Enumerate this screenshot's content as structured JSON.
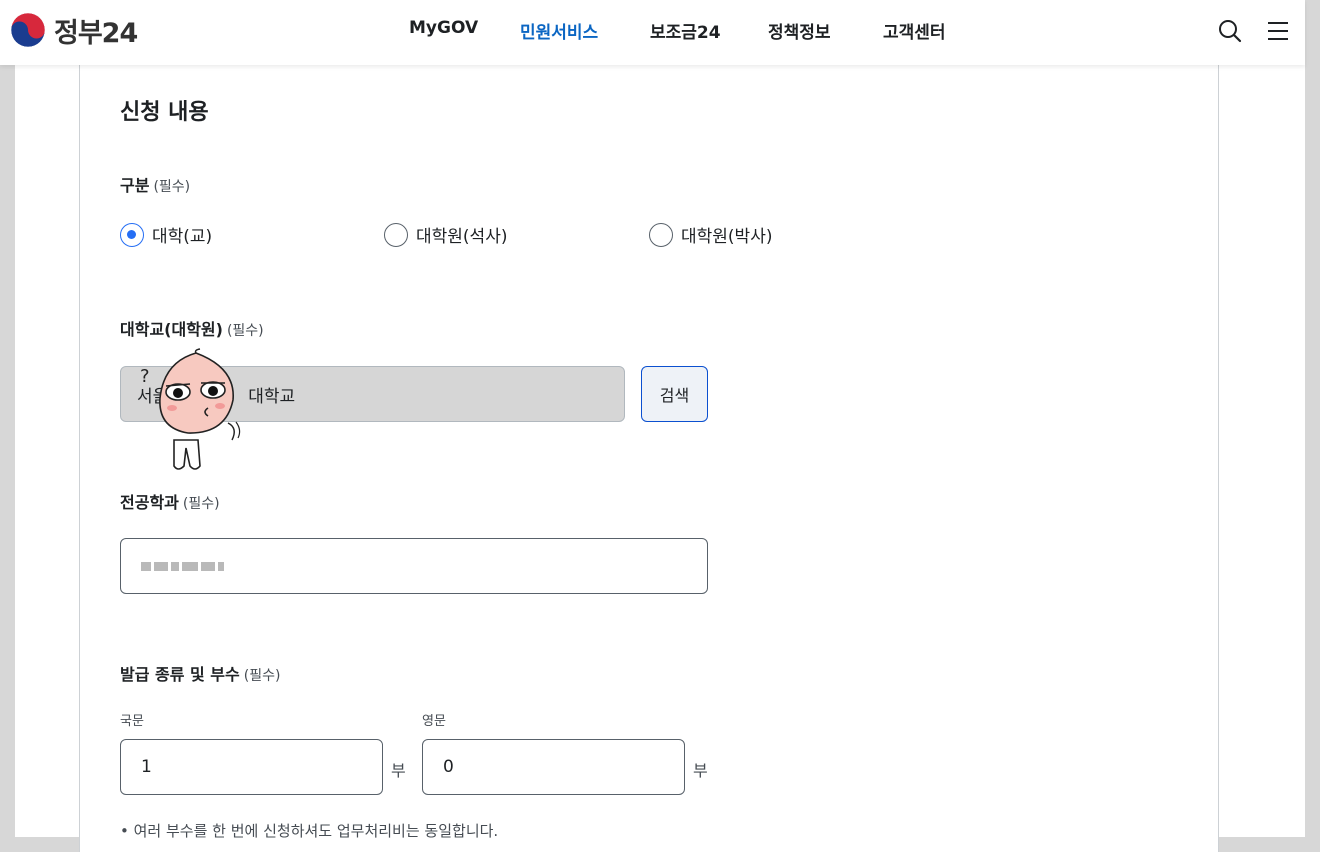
{
  "header": {
    "logo_text": "정부24",
    "nav": [
      {
        "label": "MyGOV",
        "active": false
      },
      {
        "label": "민원서비스",
        "active": true
      },
      {
        "label": "보조금24",
        "active": false
      },
      {
        "label": "정책정보",
        "active": false
      },
      {
        "label": "고객센터",
        "active": false
      }
    ],
    "icons": [
      "search-icon",
      "menu-icon"
    ]
  },
  "form": {
    "section_title": "신청 내용",
    "required_mark": "(필수)",
    "category": {
      "label": "구분",
      "options": [
        {
          "label": "대학(교)",
          "checked": true
        },
        {
          "label": "대학원(석사)",
          "checked": false
        },
        {
          "label": "대학원(박사)",
          "checked": false
        }
      ]
    },
    "university": {
      "label": "대학교(대학원)",
      "value_prefix": "서울",
      "value_suffix": "대학교",
      "search_button": "검색"
    },
    "major": {
      "label": "전공학과",
      "value": "(blurred)"
    },
    "copies": {
      "label": "발급 종류 및 부수",
      "korean_label": "국문",
      "korean_value": "1",
      "english_label": "영문",
      "english_value": "0",
      "unit": "부",
      "note": "• 여러 부수를 한 번에 신청하셔도 업무처리비는 동일합니다."
    }
  },
  "colors": {
    "accent": "#0b66c3",
    "radio_checked": "#256ef4",
    "readonly_bg": "#d6d6d6",
    "button_border": "#0b50d0"
  }
}
